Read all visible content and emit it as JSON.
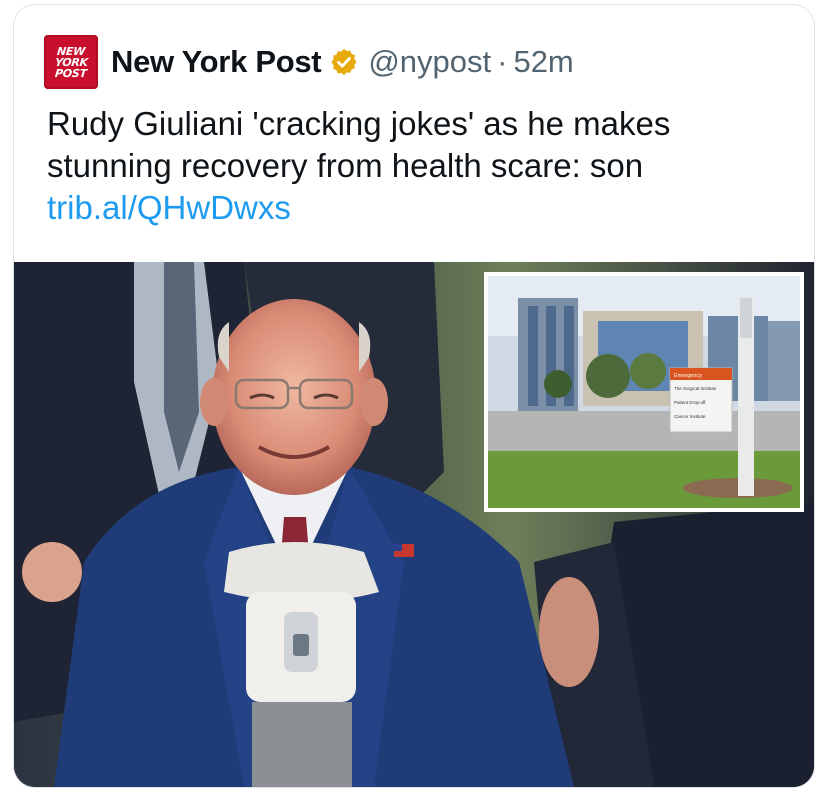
{
  "tweet": {
    "author_name": "New York Post",
    "handle": "@nypost",
    "separator": "·",
    "time_ago": "52m",
    "verified": true,
    "verified_badge_color": "#e8a90a",
    "avatar_logo_lines": [
      "NEW",
      "YORK",
      "POST"
    ],
    "avatar_color": "#c8102e",
    "text": "Rudy Giuliani 'cracking jokes' as he makes stunning recovery from health scare: son",
    "link": "trib.al/QHwDwxs",
    "link_color": "#1d9bf0"
  },
  "media": {
    "sign_lines": [
      "Emergency",
      "The Surgical Institute",
      "Patient Drop-off",
      "Cancer Institute"
    ],
    "sign_accent_color": "#d9541e"
  }
}
